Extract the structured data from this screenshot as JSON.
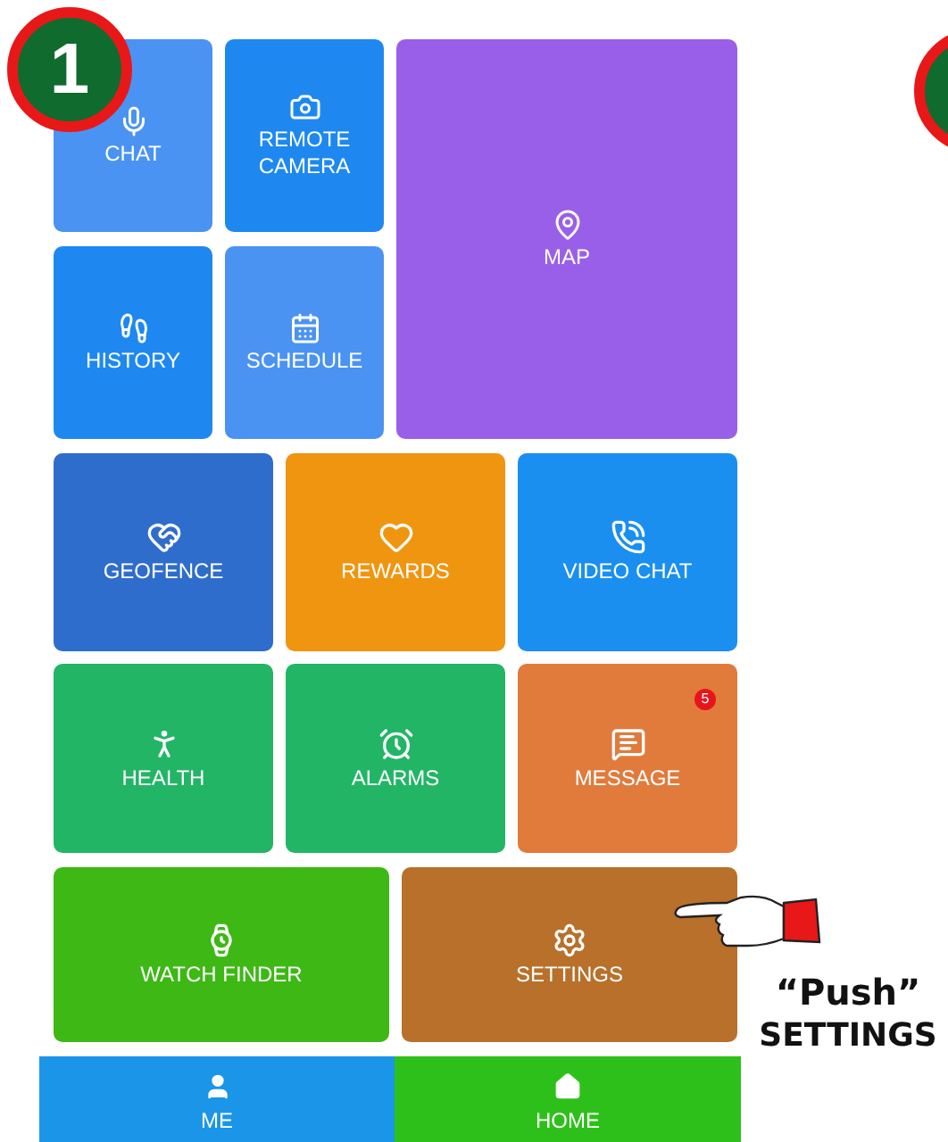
{
  "step_badge": {
    "label": "1"
  },
  "tiles_top": [
    {
      "label": "CHAT",
      "color": "#4b93f2"
    },
    {
      "label": "REMOTE CAMERA",
      "color": "#1e88f0"
    },
    {
      "label": "MAP",
      "color": "#9a5fe8"
    },
    {
      "label": "HISTORY",
      "color": "#1e88f0"
    },
    {
      "label": "SCHEDULE",
      "color": "#4b93f2"
    }
  ],
  "tiles_middle": [
    {
      "label": "GEOFENCE",
      "color": "#2f6dcc"
    },
    {
      "label": "REWARDS",
      "color": "#f0950f"
    },
    {
      "label": "VIDEO CHAT",
      "color": "#1a8ff0"
    },
    {
      "label": "HEALTH",
      "color": "#22b566"
    },
    {
      "label": "ALARMS",
      "color": "#22b566"
    },
    {
      "label": "MESSAGE",
      "color": "#e07b3c",
      "badge": "5"
    }
  ],
  "tiles_bottom": [
    {
      "label": "WATCH FINDER",
      "color": "#3db815"
    },
    {
      "label": "SETTINGS",
      "color": "#b8702b"
    }
  ],
  "bottom_nav": [
    {
      "label": "ME",
      "selected": false
    },
    {
      "label": "HOME",
      "selected": true
    }
  ],
  "annotation": {
    "line_1": "“Push”",
    "line_2": "SETTINGS"
  }
}
